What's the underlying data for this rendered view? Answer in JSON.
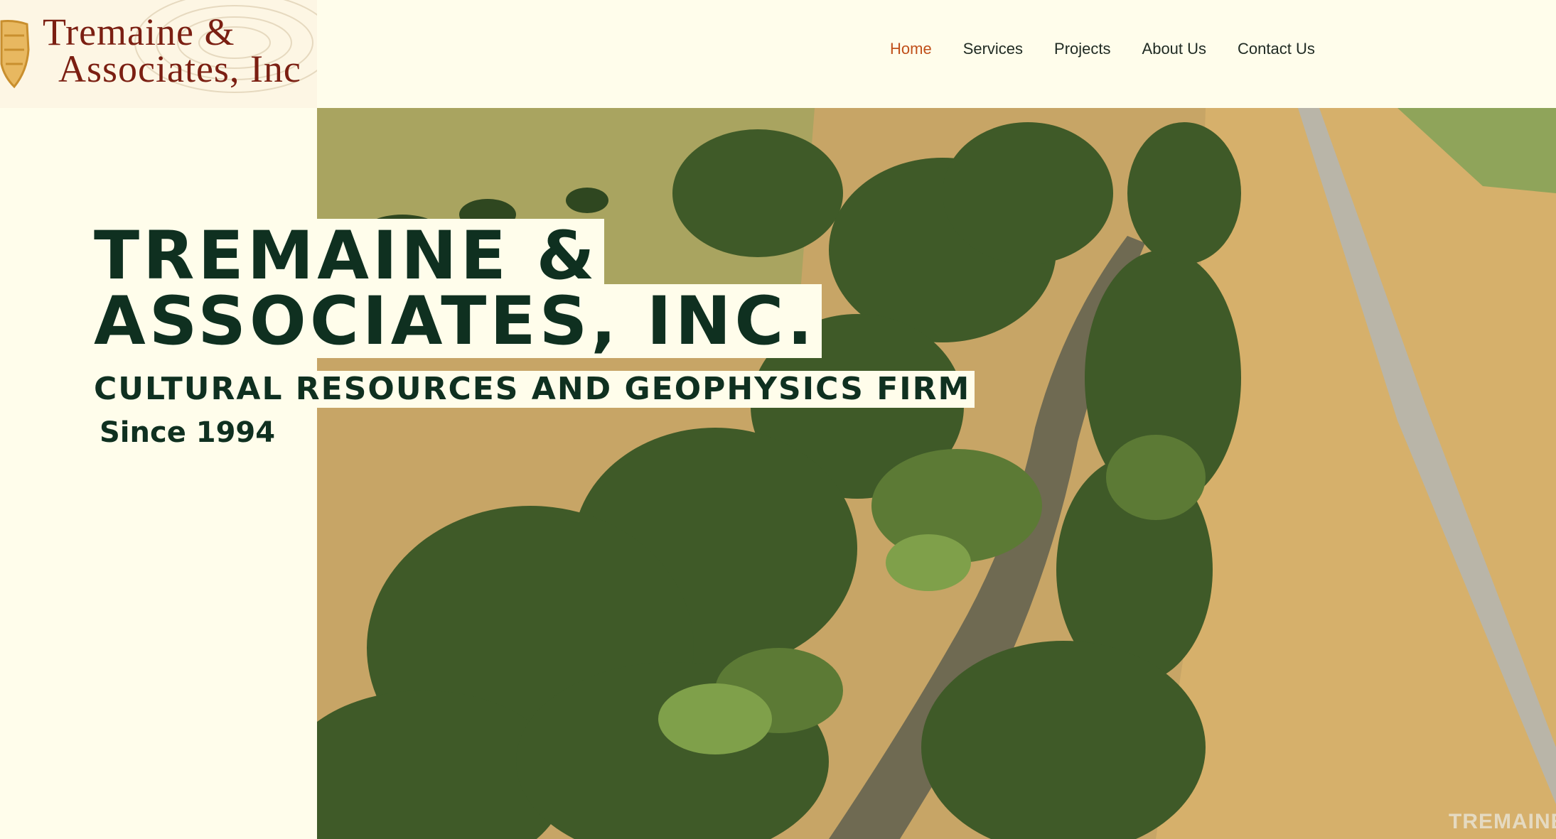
{
  "logo": {
    "line1": "Tremaine &",
    "line2": "Associates, Inc"
  },
  "nav": {
    "items": [
      {
        "label": "Home",
        "active": true
      },
      {
        "label": "Services",
        "active": false
      },
      {
        "label": "Projects",
        "active": false
      },
      {
        "label": "About Us",
        "active": false
      },
      {
        "label": "Contact Us",
        "active": false
      }
    ]
  },
  "hero": {
    "title_line1": "TREMAINE &",
    "title_line2": "ASSOCIATES, INC.",
    "subtitle": "CULTURAL RESOURCES AND GEOPHYSICS FIRM",
    "since": "Since 1994",
    "watermark": "TREMAINE"
  },
  "colors": {
    "page_background": "#fffdeb",
    "title_text": "#0f3020",
    "nav_active": "#c0501a",
    "nav_text": "#1f2a22",
    "logo_text": "#7b1f12"
  }
}
